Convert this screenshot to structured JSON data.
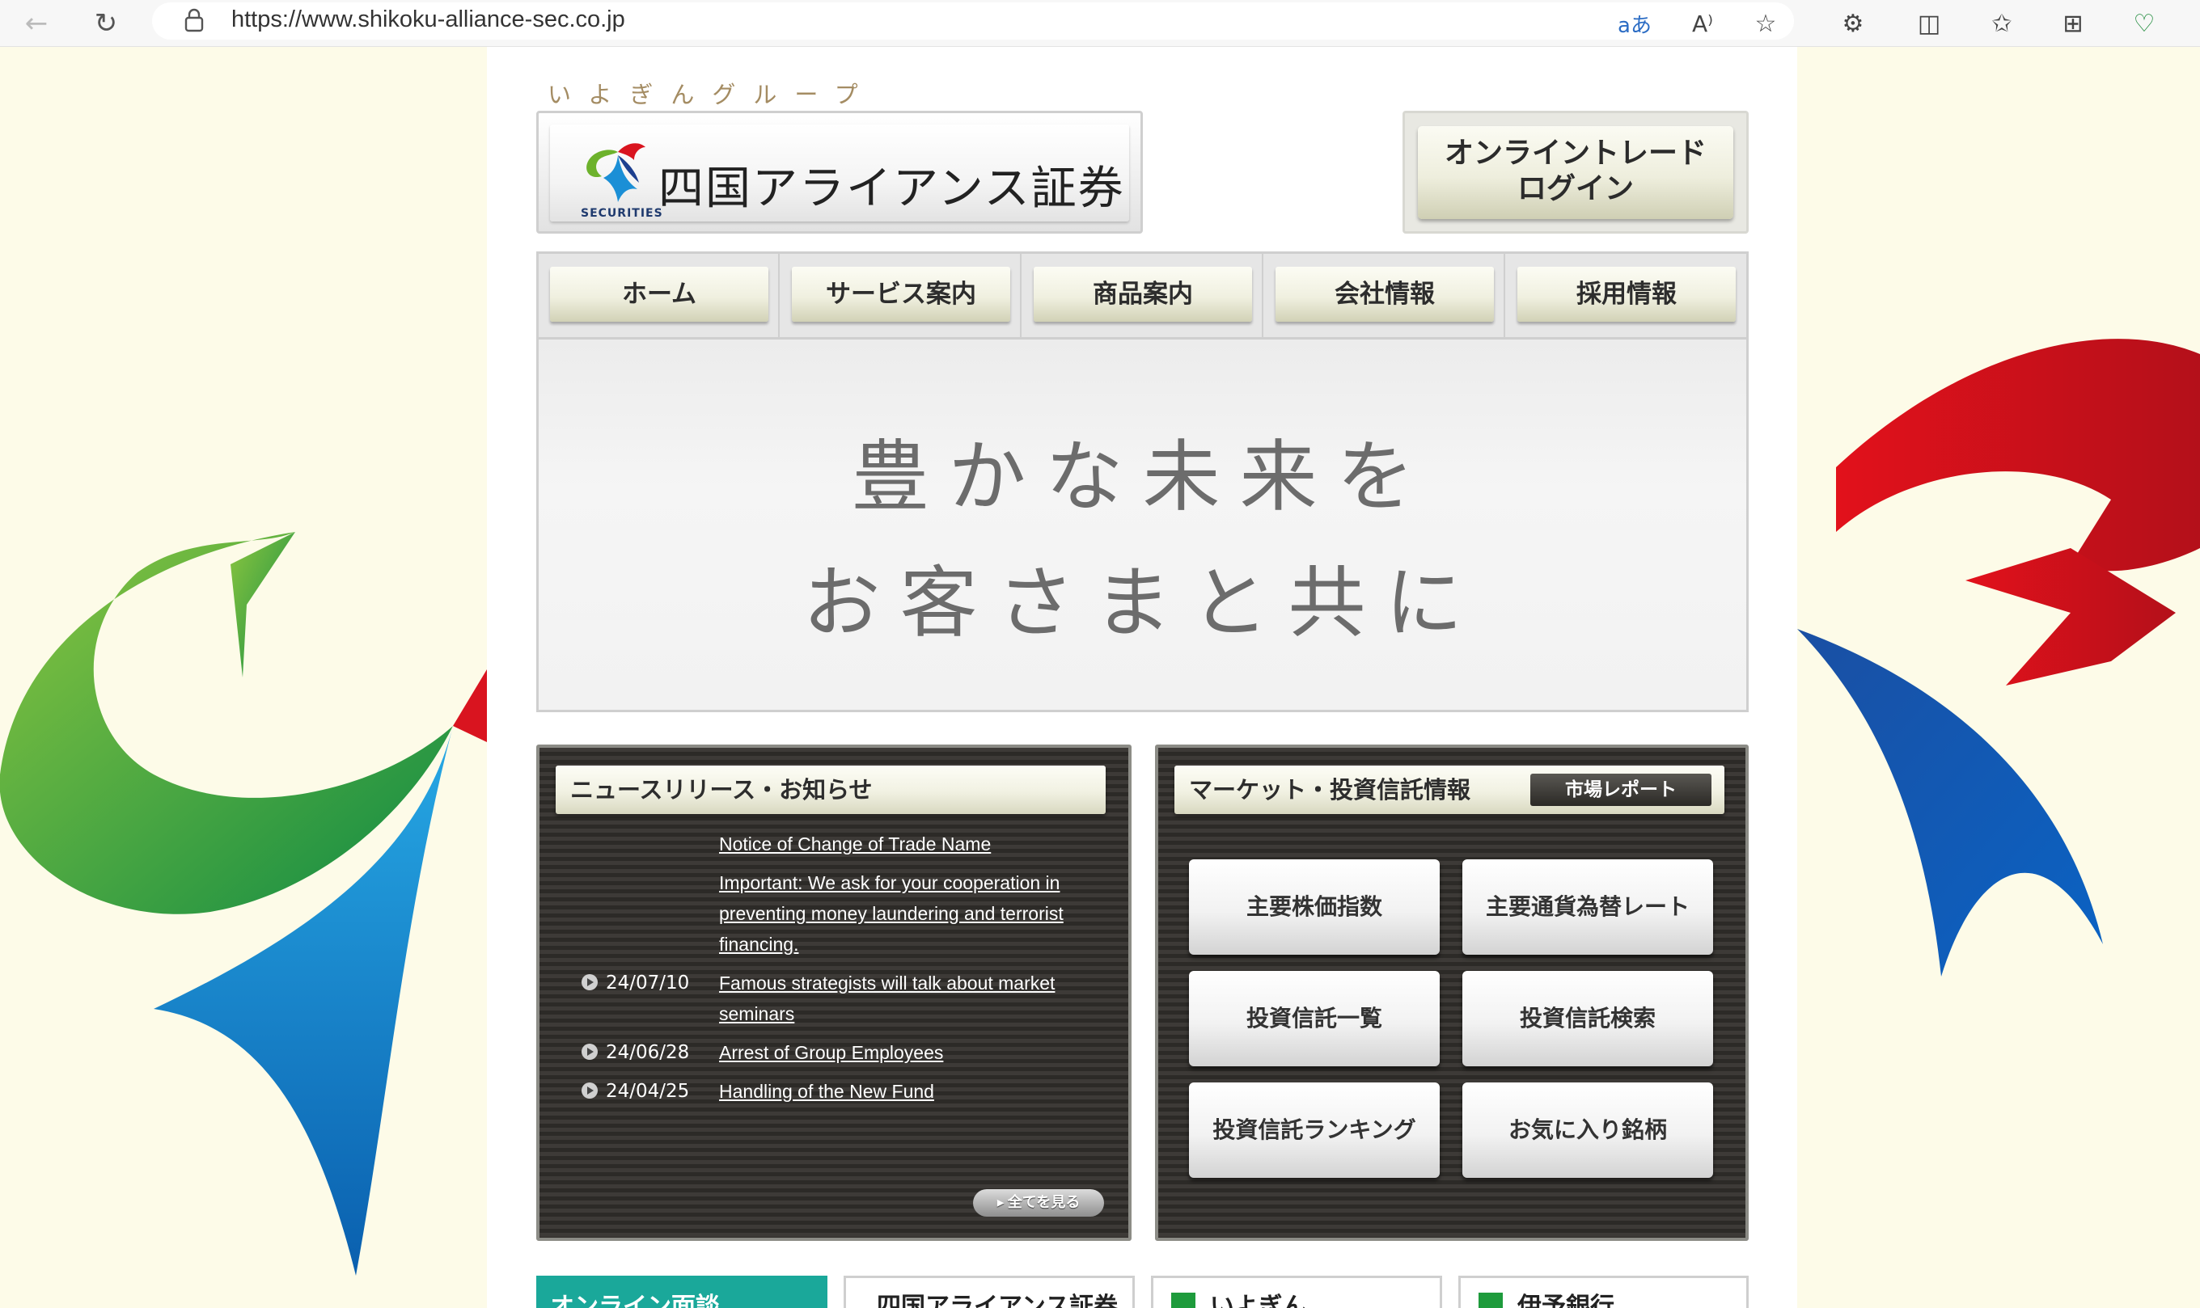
{
  "browser": {
    "url": "https://www.shikoku-alliance-sec.co.jp"
  },
  "header": {
    "group_label": "いよぎんグループ",
    "logo_name": "四国アライアンス証券",
    "logo_securities": "SECURITIES",
    "login_line1": "オンライントレード",
    "login_line2": "ログイン"
  },
  "nav": {
    "items": [
      {
        "label": "ホーム"
      },
      {
        "label": "サービス案内"
      },
      {
        "label": "商品案内"
      },
      {
        "label": "会社情報"
      },
      {
        "label": "採用情報"
      }
    ]
  },
  "hero": {
    "line1": "豊かな未来を",
    "line2": "お客さまと共に"
  },
  "news": {
    "title": "ニュースリリース・お知らせ",
    "items": [
      {
        "date": "",
        "text": "Notice of Change of Trade Name"
      },
      {
        "date": "",
        "text": "Important: We ask for your cooperation in preventing money laundering and terrorist financing."
      },
      {
        "date": "24/07/10",
        "text": "Famous strategists will talk about market seminars"
      },
      {
        "date": "24/06/28",
        "text": "Arrest of Group Employees"
      },
      {
        "date": "24/04/25",
        "text": "Handling of the New Fund"
      }
    ],
    "more_label": "全てを見る"
  },
  "market": {
    "title": "マーケット・投資信託情報",
    "report_label": "市場レポート",
    "buttons": [
      {
        "label": "主要株価指数"
      },
      {
        "label": "主要通貨為替レート"
      },
      {
        "label": "投資信託一覧"
      },
      {
        "label": "投資信託検索"
      },
      {
        "label": "投資信託ランキング"
      },
      {
        "label": "お気に入り銘柄"
      }
    ]
  },
  "banners": [
    {
      "label": "オンライン面談"
    },
    {
      "label": "四国アライアンス証券"
    },
    {
      "label": "いよぎん"
    },
    {
      "label": "伊予銀行"
    }
  ],
  "colors": {
    "green": "#6db22c",
    "blue": "#1b8fd6",
    "red": "#d9141f",
    "navy": "#1d3f8f",
    "teal": "#1aa89a"
  }
}
